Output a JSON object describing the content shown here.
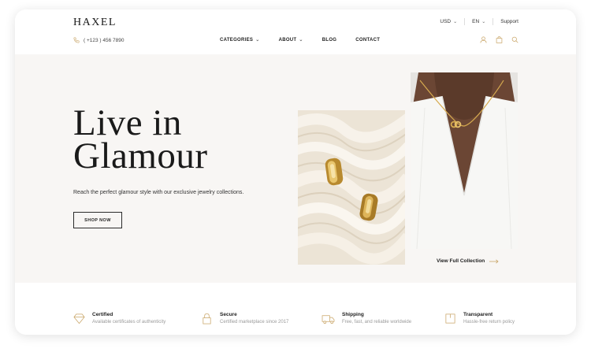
{
  "brand": {
    "logo": "HAXEL",
    "phone": "( +123 ) 456 7890"
  },
  "topbar": {
    "currency": "USD",
    "language": "EN",
    "support": "Support"
  },
  "nav": [
    {
      "label": "CATEGORIES",
      "has_dropdown": true
    },
    {
      "label": "ABOUT",
      "has_dropdown": true
    },
    {
      "label": "BLOG",
      "has_dropdown": false
    },
    {
      "label": "CONTACT",
      "has_dropdown": false
    }
  ],
  "header_icons": [
    "user-icon",
    "bag-icon",
    "search-icon"
  ],
  "hero": {
    "title_line1": "Live in",
    "title_line2": "Glamour",
    "subtitle": "Reach the perfect glamour style with our exclusive jewelry collections.",
    "cta": "SHOP NOW",
    "view_collection": "View Full Collection"
  },
  "features": [
    {
      "icon": "diamond-icon",
      "title": "Certified",
      "desc": "Available certificates of authenticity"
    },
    {
      "icon": "lock-icon",
      "title": "Secure",
      "desc": "Certified marketplace since 2017"
    },
    {
      "icon": "truck-icon",
      "title": "Shipping",
      "desc": "Free, fast, and reliable worldwide"
    },
    {
      "icon": "box-icon",
      "title": "Transparent",
      "desc": "Hassle-free return policy"
    }
  ],
  "colors": {
    "accent": "#c9a567",
    "hero_bg": "#f8f6f4",
    "text": "#1a1a1a",
    "muted": "#9a9a9a"
  }
}
